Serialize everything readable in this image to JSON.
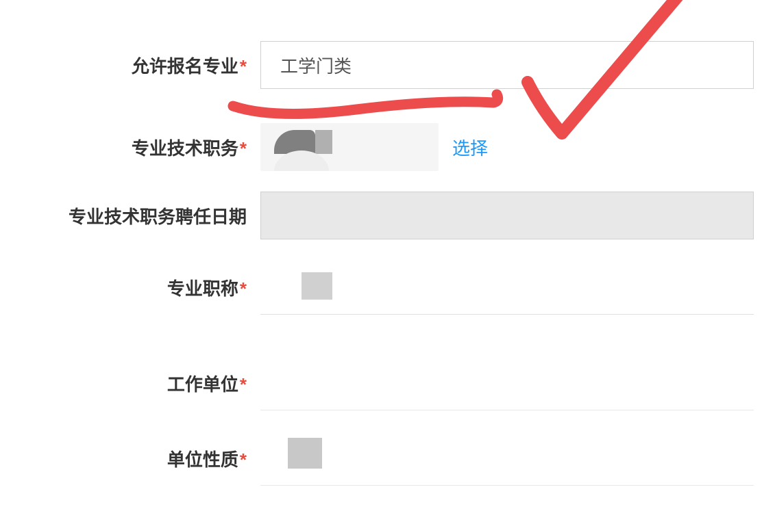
{
  "form": {
    "allowed_major": {
      "label": "允许报名专业",
      "value": "工学门类",
      "required": true
    },
    "tech_position": {
      "label": "专业技术职务",
      "required": true,
      "select_label": "选择"
    },
    "appointment_date": {
      "label": "专业技术职务聘任日期",
      "required": false,
      "value": ""
    },
    "professional_title": {
      "label": "专业职称",
      "required": true
    },
    "workplace": {
      "label": "工作单位",
      "required": true
    },
    "unit_nature": {
      "label": "单位性质",
      "required": true
    }
  },
  "required_mark": "*"
}
